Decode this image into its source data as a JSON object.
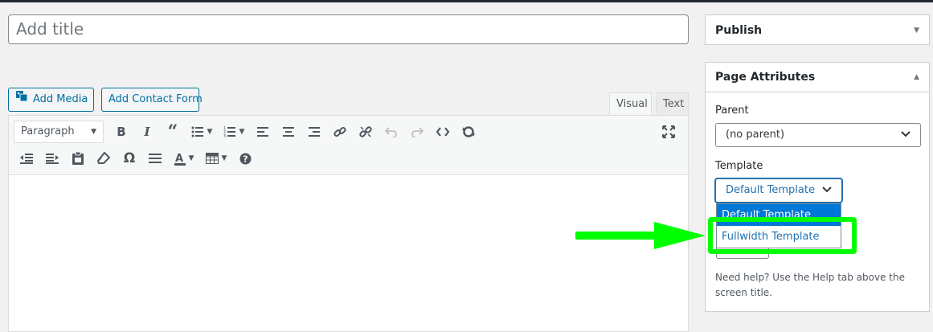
{
  "title": {
    "placeholder": "Add title"
  },
  "media_buttons": {
    "add_media": "Add Media",
    "add_contact_form": "Add Contact Form"
  },
  "editor": {
    "tabs": {
      "visual": "Visual",
      "text": "Text"
    },
    "format_select": "Paragraph",
    "toolbar_row1_icons": [
      "bold-icon",
      "italic-icon",
      "blockquote-icon",
      "bullet-list-icon",
      "numbered-list-icon",
      "align-left-icon",
      "align-center-icon",
      "align-right-icon",
      "link-icon",
      "unlink-icon",
      "undo-icon",
      "redo-icon",
      "code-icon",
      "refresh-icon",
      "fullscreen-icon"
    ],
    "toolbar_row2_icons": [
      "outdent-icon",
      "indent-icon",
      "paste-icon",
      "eraser-icon",
      "omega-icon",
      "horizontal-rule-icon",
      "text-color-icon",
      "table-icon",
      "help-icon"
    ]
  },
  "publish": {
    "title": "Publish"
  },
  "page_attributes": {
    "title": "Page Attributes",
    "parent_label": "Parent",
    "parent_value": "(no parent)",
    "template_label": "Template",
    "template_value": "Default Template",
    "template_options": [
      "Default Template",
      "Fullwidth Template"
    ],
    "help_text": "Need help? Use the Help tab above the screen title."
  },
  "colors": {
    "accent": "#2271b1",
    "annotation": "#00ff00",
    "selected_option": "#0078d7"
  }
}
